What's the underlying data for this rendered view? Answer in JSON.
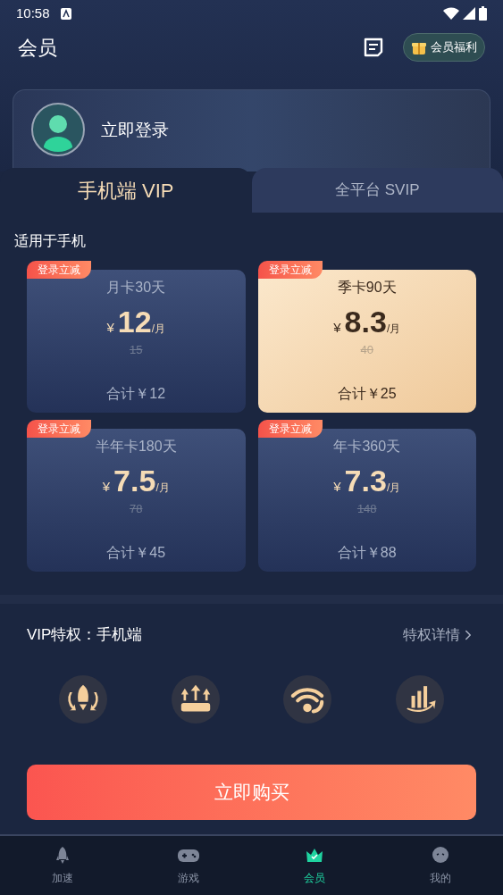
{
  "status_bar": {
    "time": "10:58"
  },
  "header": {
    "title": "会员",
    "benefits_button": "会员福利"
  },
  "login": {
    "label": "立即登录"
  },
  "tabs": [
    {
      "label": "手机端 VIP",
      "selected": true
    },
    {
      "label": "全平台 SVIP",
      "selected": false
    }
  ],
  "plans_heading": "适用于手机",
  "plans": [
    {
      "badge": "登录立减",
      "name": "月卡30天",
      "currency": "¥",
      "price": "12",
      "unit": "/月",
      "original": "15",
      "total": "合计￥12",
      "selected": false
    },
    {
      "badge": "登录立减",
      "name": "季卡90天",
      "currency": "¥",
      "price": "8.3",
      "unit": "/月",
      "original": "40",
      "total": "合计￥25",
      "selected": true
    },
    {
      "badge": "登录立减",
      "name": "半年卡180天",
      "currency": "¥",
      "price": "7.5",
      "unit": "/月",
      "original": "78",
      "total": "合计￥45",
      "selected": false
    },
    {
      "badge": "登录立减",
      "name": "年卡360天",
      "currency": "¥",
      "price": "7.3",
      "unit": "/月",
      "original": "148",
      "total": "合计￥88",
      "selected": false
    }
  ],
  "privileges": {
    "title": "VIP特权：手机端",
    "details_link": "特权详情",
    "items": [
      {
        "kind": "rocket"
      },
      {
        "kind": "upload"
      },
      {
        "kind": "wifi"
      },
      {
        "kind": "chart"
      }
    ]
  },
  "buy_button": "立即购买",
  "bottom_nav": [
    {
      "label": "加速",
      "kind": "rocket",
      "selected": false
    },
    {
      "label": "游戏",
      "kind": "gamepad",
      "selected": false
    },
    {
      "label": "会员",
      "kind": "crown",
      "selected": true
    },
    {
      "label": "我的",
      "kind": "face",
      "selected": false
    }
  ]
}
